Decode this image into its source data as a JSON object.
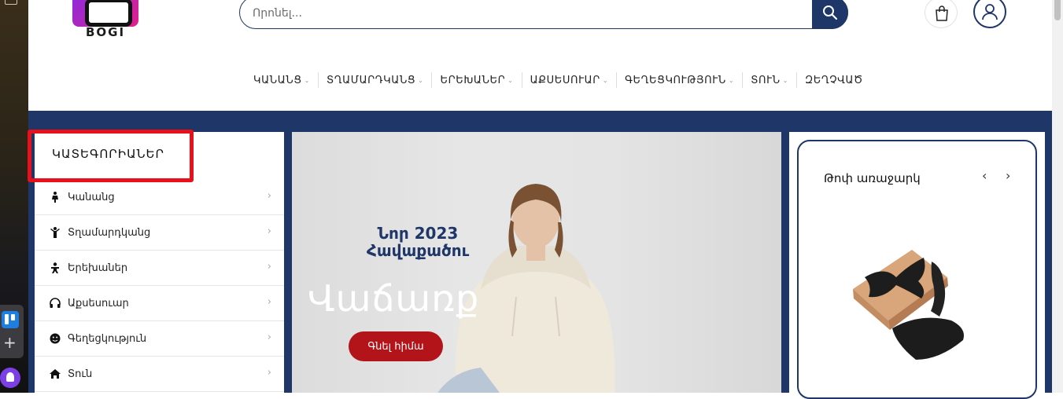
{
  "brand": {
    "name": "BOGI"
  },
  "search": {
    "placeholder": "Որոնել..."
  },
  "cart": {
    "count": "0"
  },
  "nav": {
    "items": [
      {
        "label": "Կանանց"
      },
      {
        "label": "Տղամարդկանց"
      },
      {
        "label": "Երեխաներ"
      },
      {
        "label": "Աքսեսուար"
      },
      {
        "label": "Գեղեցկություն"
      },
      {
        "label": "Տուն"
      },
      {
        "label": "Զեղչված"
      }
    ]
  },
  "categories": {
    "title": "ԿԱՏԵԳՈՐԻԱՆԵՐ",
    "items": [
      {
        "label": "Կանանց",
        "icon": "female-icon"
      },
      {
        "label": "Տղամարդկանց",
        "icon": "male-icon"
      },
      {
        "label": "Երեխաներ",
        "icon": "child-icon"
      },
      {
        "label": "Աքսեսուար",
        "icon": "headphones-icon"
      },
      {
        "label": "Գեղեցկություն",
        "icon": "face-icon"
      },
      {
        "label": "Տուն",
        "icon": "home-icon"
      }
    ]
  },
  "hero": {
    "subtitle": "Նոր 2023 Հավաքածու",
    "headline": "Վաճառք",
    "cta": "Գնել հիմա"
  },
  "offer": {
    "title": "Թոփ առաջարկ"
  },
  "colors": {
    "primary": "#1f3669",
    "accent": "#b3141a",
    "highlight": "#e8101a"
  }
}
